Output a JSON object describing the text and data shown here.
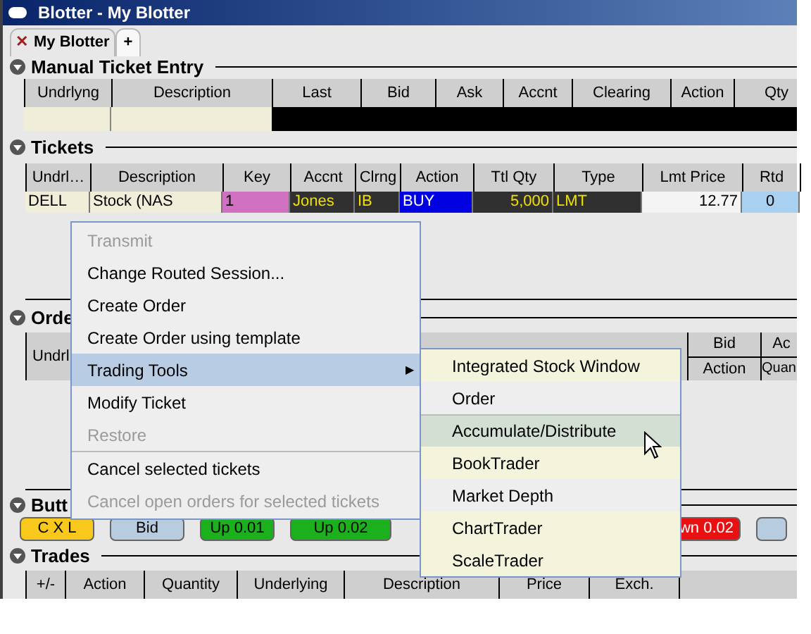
{
  "window": {
    "title": "Blotter - My Blotter"
  },
  "tabs": [
    {
      "label": "My Blotter",
      "selected": true,
      "close_icon": "✕"
    },
    {
      "label": "+",
      "selected": false
    }
  ],
  "manual_entry": {
    "title": "Manual Ticket Entry",
    "expanded": true,
    "columns": [
      "Undrlyng",
      "Description",
      "Last",
      "Bid",
      "Ask",
      "Accnt",
      "Clearing",
      "Action",
      "Qty"
    ]
  },
  "tickets": {
    "title": "Tickets",
    "expanded": true,
    "columns": [
      "Undrl…",
      "Description",
      "Key",
      "Accnt",
      "Clrng",
      "Action",
      "Ttl Qty",
      "Type",
      "Lmt Price",
      "Rtd"
    ],
    "rows": [
      {
        "cells": [
          "DELL",
          "Stock (NAS",
          "1",
          "Jones",
          "IB",
          "BUY",
          "5,000",
          "LMT",
          "12.77",
          "0"
        ]
      }
    ]
  },
  "orders": {
    "title": "Orde",
    "expanded": true,
    "columns": [
      {
        "bottom": "Undrl"
      },
      {
        "top": "Bid",
        "bottom": "Action"
      },
      {
        "top": "Ac",
        "bottom": "Quan"
      }
    ]
  },
  "buttons_panel": {
    "title": "Butt",
    "expanded": true,
    "buttons": [
      {
        "label": "C X L",
        "color": "#f8c81c"
      },
      {
        "label": "Bid",
        "color": "#b8cce0"
      },
      {
        "label": "Up 0.01",
        "color": "#1cb01c"
      },
      {
        "label": "Up 0.02",
        "color": "#1cb01c"
      },
      {
        "label": "wn 0.02",
        "color": "#e81010"
      },
      {
        "color": "#b8cce0"
      }
    ]
  },
  "trades": {
    "title": "Trades",
    "expanded": true,
    "columns": [
      "+/-",
      "Action",
      "Quantity",
      "Underlying",
      "Description",
      "Price",
      "Exch."
    ]
  },
  "context_menu": {
    "items": [
      {
        "label": "Transmit",
        "disabled": true,
        "selected": false
      },
      {
        "label": "Change Routed Session...",
        "disabled": false,
        "selected": false
      },
      {
        "label": "Create Order",
        "disabled": false,
        "selected": false
      },
      {
        "label": "Create Order using template",
        "disabled": false,
        "selected": false
      },
      {
        "label": "Trading Tools",
        "disabled": false,
        "selected": true,
        "arrow": "▶"
      },
      {
        "label": "Modify Ticket",
        "disabled": false,
        "selected": false
      },
      {
        "label": "Restore",
        "disabled": true,
        "selected": false
      },
      {
        "label": "Cancel selected tickets",
        "disabled": false,
        "selected": false
      },
      {
        "label": "Cancel open orders for selected tickets",
        "disabled": true,
        "selected": false
      }
    ]
  },
  "submenu": {
    "items": [
      {
        "label": "Integrated Stock Window",
        "selected": false
      },
      {
        "label": "Order",
        "selected": false
      },
      {
        "label": "Accumulate/Distribute",
        "selected": true
      },
      {
        "label": "BookTrader",
        "selected": false
      },
      {
        "label": "Market Depth",
        "selected": false
      },
      {
        "label": "ChartTrader",
        "selected": false
      },
      {
        "label": "ScaleTrader",
        "selected": false
      }
    ]
  }
}
